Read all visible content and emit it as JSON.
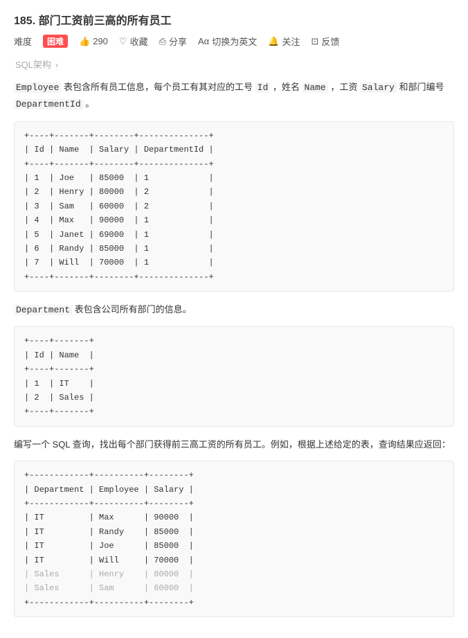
{
  "page": {
    "title": "185. 部门工资前三高的所有员工",
    "difficulty_label": "难度",
    "badge": "困难",
    "like_count": "290",
    "actions": [
      {
        "id": "collect",
        "label": "收藏",
        "icon": "heart-icon"
      },
      {
        "id": "share",
        "label": "分享",
        "icon": "share-icon"
      },
      {
        "id": "translate",
        "label": "切换为英文",
        "icon": "translate-icon"
      },
      {
        "id": "follow",
        "label": "关注",
        "icon": "bell-icon"
      },
      {
        "id": "feedback",
        "label": "反馈",
        "icon": "feedback-icon"
      }
    ],
    "breadcrumb": "SQL架构",
    "breadcrumb_arrow": "›",
    "description_parts": [
      {
        "text": "Employee",
        "type": "code"
      },
      {
        "text": " 表包含所有员工信息，每个员工有其对应的工号 ",
        "type": "text"
      },
      {
        "text": "Id",
        "type": "code"
      },
      {
        "text": " ，姓名 ",
        "type": "text"
      },
      {
        "text": "Name",
        "type": "code"
      },
      {
        "text": " ，工资 ",
        "type": "text"
      },
      {
        "text": "Salary",
        "type": "code"
      },
      {
        "text": " 和部门编号 ",
        "type": "text"
      },
      {
        "text": "DepartmentId",
        "type": "code"
      },
      {
        "text": " 。",
        "type": "text"
      }
    ],
    "employee_table": "+----+-------+--------+--------------+\n| Id | Name  | Salary | DepartmentId |\n+----+-------+--------+--------------+\n| 1  | Joe   | 85000  | 1            |\n| 2  | Henry | 80000  | 2            |\n| 3  | Sam   | 60000  | 2            |\n| 4  | Max   | 90000  | 1            |\n| 5  | Janet | 69000  | 1            |\n| 6  | Randy | 85000  | 1            |\n| 7  | Will  | 70000  | 1            |\n+----+-------+--------+--------------+",
    "dept_desc_parts": [
      {
        "text": "Department",
        "type": "code"
      },
      {
        "text": " 表包含公司所有部门的信息。",
        "type": "text"
      }
    ],
    "department_table": "+----+-------+\n| Id | Name  |\n+----+-------+\n| 1  | IT    |\n| 2  | Sales |\n+----+-------+",
    "query_desc": "编写一个 SQL 查询，找出每个部门获得前三高工资的所有员工。例如，根据上述给定的表，查询结果应返回：",
    "result_table_header": "+------------+----------+--------+\n| Department | Employee | Salary |\n+------------+----------+--------+",
    "result_table_sep": "+------------+----------+--------+",
    "result_rows": [
      "| IT         | Max      | 90000  |",
      "| IT         | Randy    | 85000  |",
      "| IT         | Joe      | 85000  |",
      "| IT         | Will     | 70000  |",
      "| Sales      | Henry    | 80000  |",
      "| Sales      | Sam      | 60000  |"
    ]
  }
}
